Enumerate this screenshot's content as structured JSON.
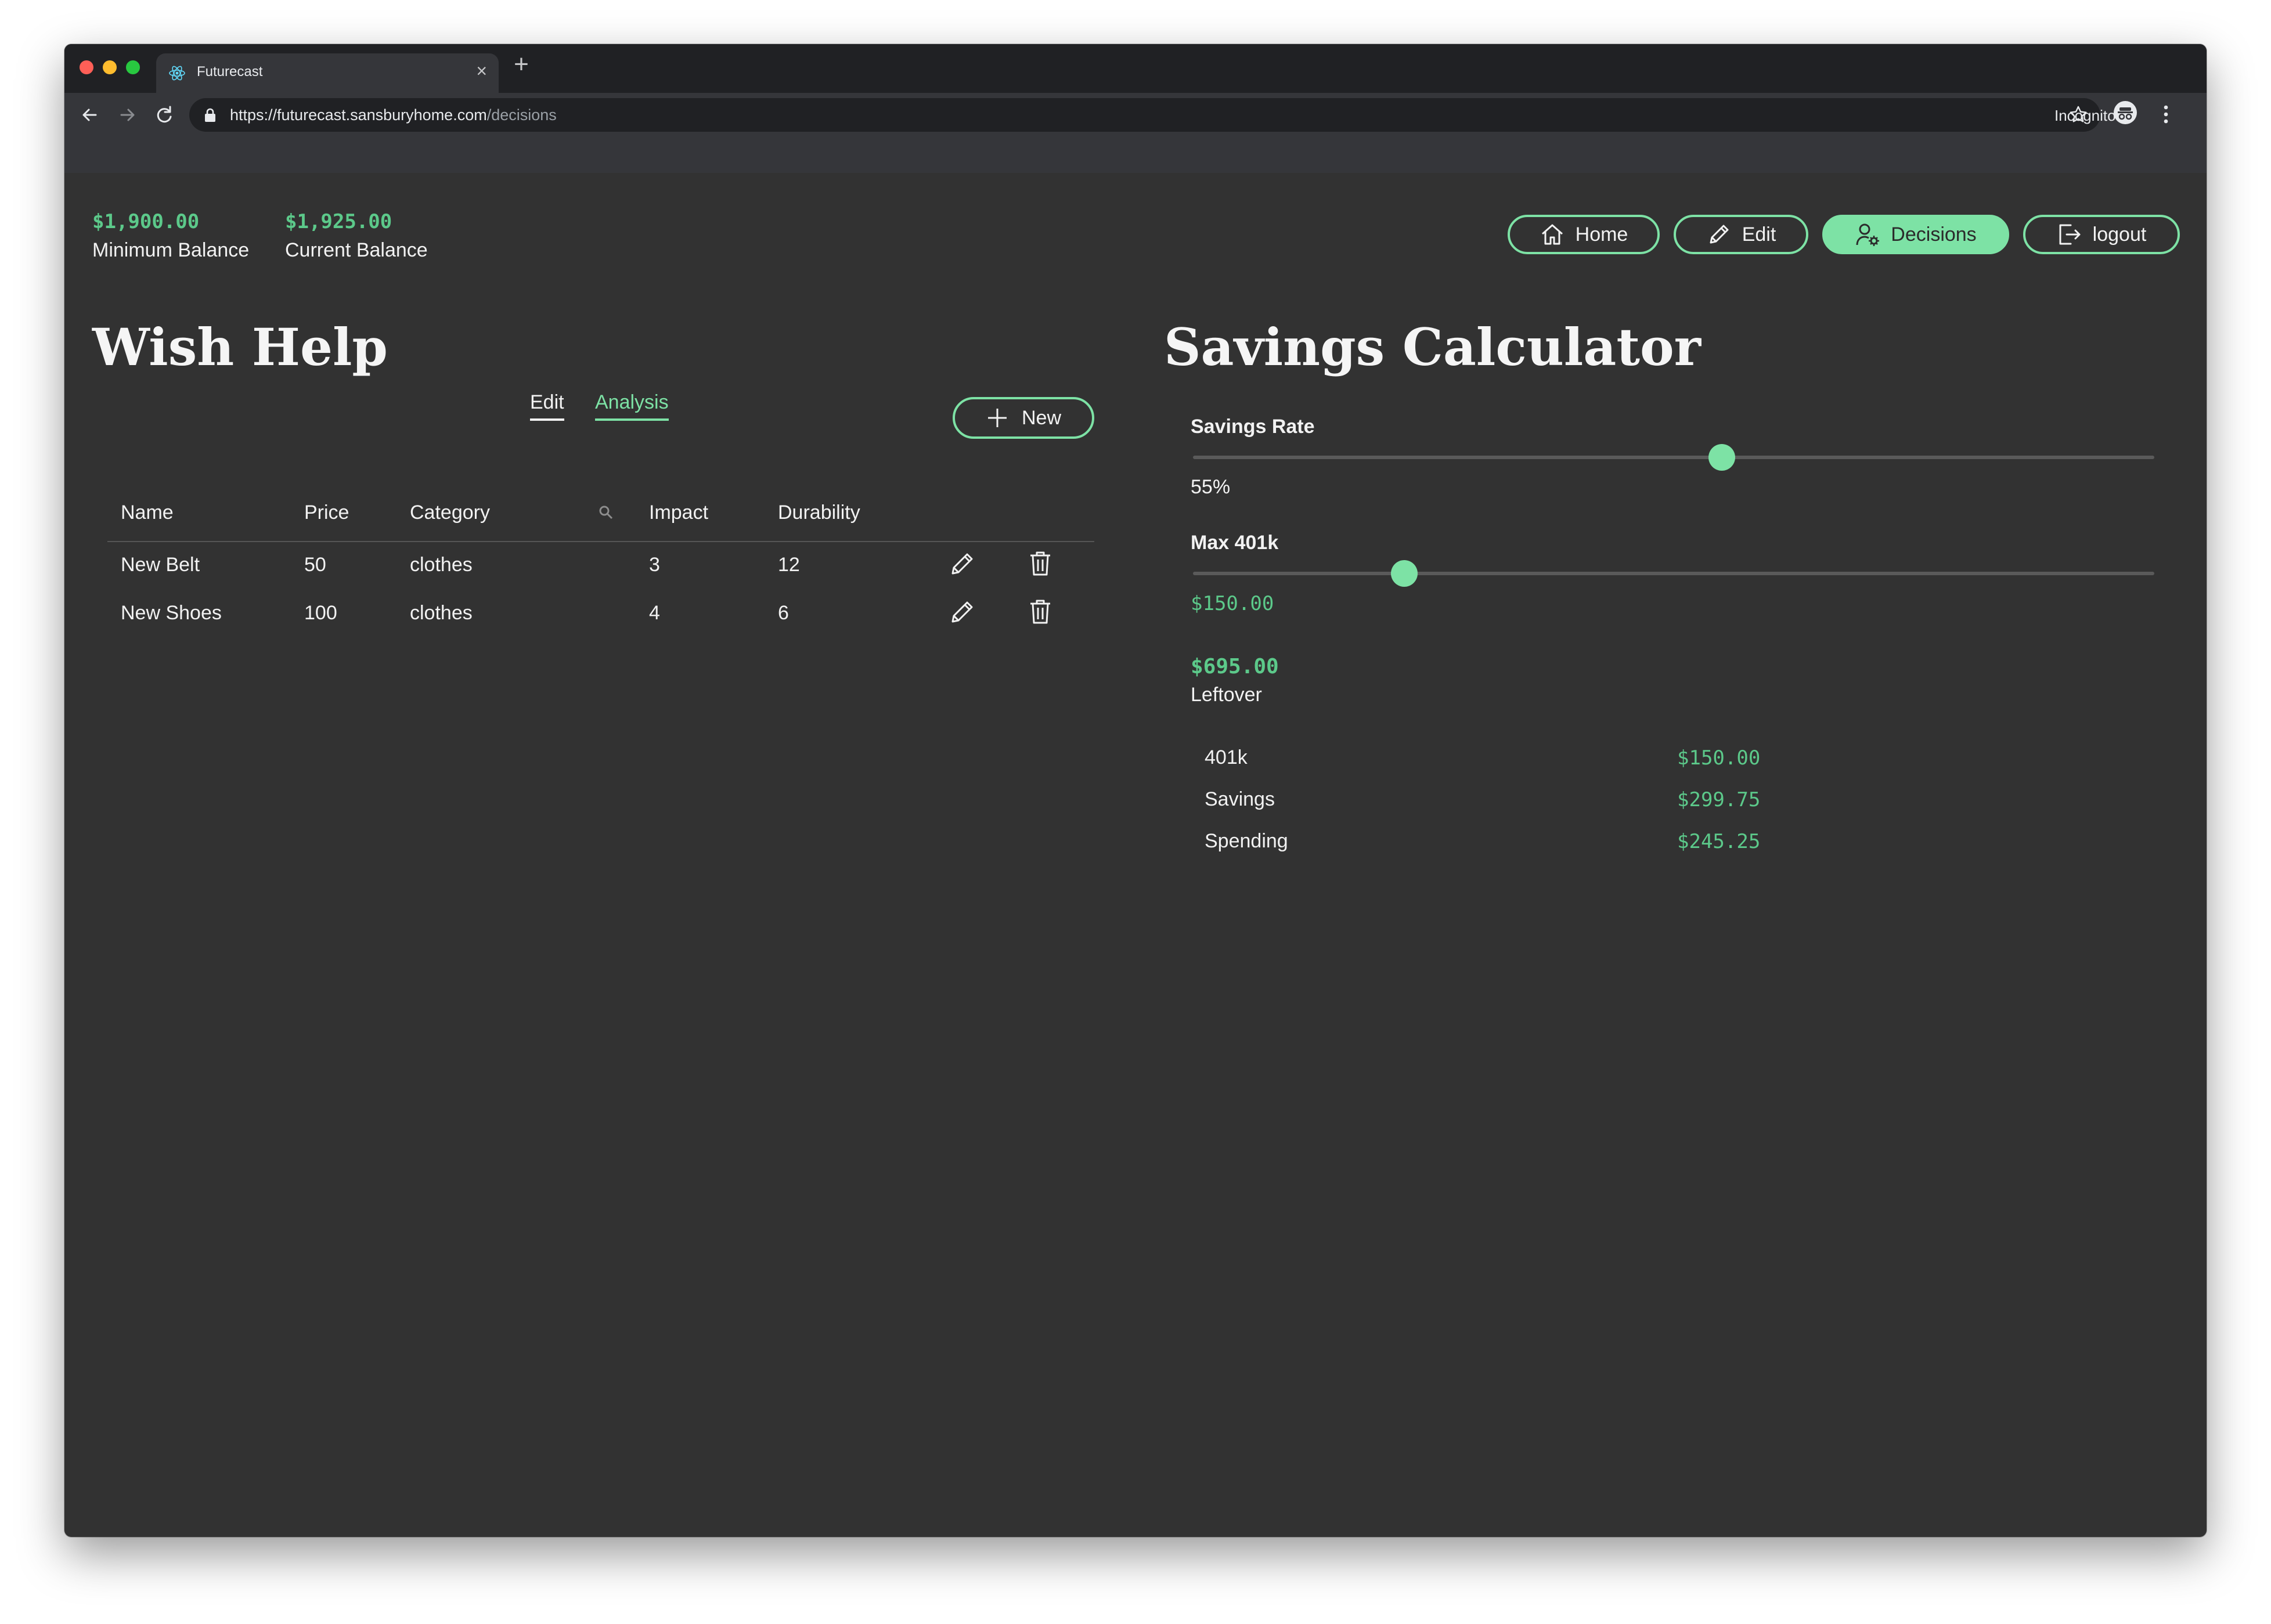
{
  "browser": {
    "tab_title": "Futurecast",
    "url_host": "https://futurecast.sansburyhome.com",
    "url_path": "/decisions",
    "incognito_label": "Incognito"
  },
  "balances": {
    "minimum_value": "$1,900.00",
    "minimum_label": "Minimum Balance",
    "current_value": "$1,925.00",
    "current_label": "Current Balance"
  },
  "nav": {
    "home": "Home",
    "edit": "Edit",
    "decisions": "Decisions",
    "logout": "logout",
    "active": "decisions"
  },
  "wish_help": {
    "title": "Wish Help",
    "tabs": {
      "edit": "Edit",
      "analysis": "Analysis",
      "active": "analysis"
    },
    "new_button": "New",
    "columns": [
      "Name",
      "Price",
      "Category",
      "Impact",
      "Durability"
    ],
    "rows": [
      {
        "name": "New Belt",
        "price": "50",
        "category": "clothes",
        "impact": "3",
        "durability": "12"
      },
      {
        "name": "New Shoes",
        "price": "100",
        "category": "clothes",
        "impact": "4",
        "durability": "6"
      }
    ]
  },
  "savings": {
    "title": "Savings Calculator",
    "savings_rate_label": "Savings Rate",
    "savings_rate_value": "55%",
    "savings_rate_fraction": 0.55,
    "max401k_label": "Max 401k",
    "max401k_value": "$150.00",
    "max401k_fraction": 0.22,
    "leftover_value": "$695.00",
    "leftover_label": "Leftover",
    "breakdown": [
      {
        "label": "401k",
        "value": "$150.00"
      },
      {
        "label": "Savings",
        "value": "$299.75"
      },
      {
        "label": "Spending",
        "value": "$245.25"
      }
    ]
  },
  "colors": {
    "accent": "#7de2a5",
    "money": "#5cc98a",
    "background": "#323232"
  },
  "icons": {
    "home": "home-icon",
    "edit": "pencil-icon",
    "decisions": "user-gear-icon",
    "logout": "logout-icon",
    "new": "plus-icon",
    "search": "search-icon",
    "row_edit": "pencil-icon",
    "row_delete": "trash-icon"
  }
}
